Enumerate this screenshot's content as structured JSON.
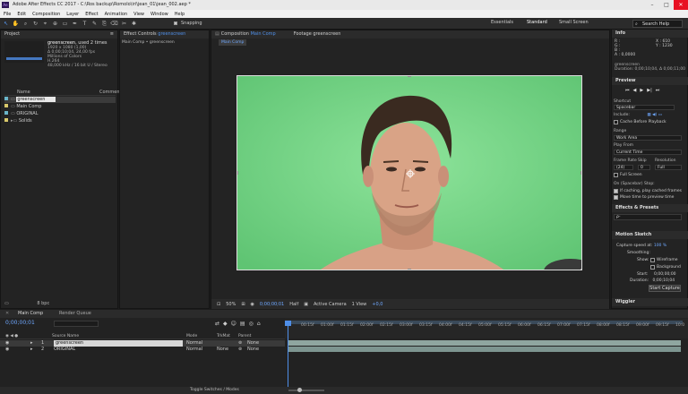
{
  "app": {
    "title": "Adobe After Effects CC 2017 - C:\\Ros backup\\Romolo\\iri\\jean_01\\jean_002.aep *",
    "menu": [
      "File",
      "Edit",
      "Composition",
      "Layer",
      "Effect",
      "Animation",
      "View",
      "Window",
      "Help"
    ],
    "snapping": "Snapping",
    "workspaces": [
      "Essentials",
      "Standard",
      "Small Screen"
    ],
    "search_help": "Search Help",
    "tools": [
      "selection",
      "hand",
      "zoom",
      "rotate",
      "camera",
      "pan-behind",
      "rectangle",
      "pen",
      "type",
      "brush",
      "clone",
      "eraser",
      "roto",
      "puppet"
    ]
  },
  "project": {
    "tab": "Project",
    "thumb_name": "greenscreen",
    "thumb_used": ", used 2 times",
    "info_lines": [
      "1920 x 1080 (1,00)",
      "Δ 0;00;10;04, 24,00 fps",
      "Millions of Colors",
      "H.264",
      "48,000 kHz / 16 bit U / Stereo"
    ],
    "col_name": "Name",
    "col_comment": "Comment",
    "items": [
      {
        "name": "greenscreen",
        "color": "#6ab5c9"
      },
      {
        "name": "Main Comp",
        "color": "#d8c86a"
      },
      {
        "name": "ORIGINAL",
        "color": "#6ab5c9"
      },
      {
        "name": "Solids",
        "color": "#d8c86a"
      }
    ],
    "bpc": "8 bpc"
  },
  "effect_controls": {
    "tab_prefix": "Effect Controls",
    "tab_target": "greenscreen",
    "breadcrumb": "Main Comp • greenscreen"
  },
  "composition": {
    "tab_prefix": "Composition",
    "tab_name": "Main Comp",
    "footage_tab": "Footage greenscreen",
    "sub_tab": "Main Comp",
    "zoom": "50%",
    "timecode": "0;00;00;01",
    "resolution": "Half",
    "camera": "Active Camera",
    "views": "1 View",
    "exposure": "+0,0"
  },
  "info": {
    "title": "Info",
    "rgb": [
      "R :",
      "G :",
      "B :",
      "A : 0,0000"
    ],
    "xy": [
      "X : 610",
      "Y : 1230"
    ],
    "footage": "greenscreen",
    "duration": "Duration: 0;00;10;04, Δ 0;00;11;00"
  },
  "preview": {
    "title": "Preview",
    "shortcut_label": "Shortcut",
    "shortcut": "Spacebar",
    "include_label": "Include:",
    "cache": "Cache Before Playback",
    "range_label": "Range",
    "range": "Work Area",
    "play_from_label": "Play From",
    "play_from": "Current Time",
    "frame_rate_label": "Frame Rate",
    "skip_label": "Skip",
    "resolution_label": "Resolution",
    "frame_rate": "(24)",
    "skip": "0",
    "resolution": "Full",
    "full_screen": "Full Screen",
    "stop_label": "On (Spacebar) Stop:",
    "if_caching": "If caching, play cached frames",
    "move_time": "Move time to preview time"
  },
  "effects_presets": {
    "title": "Effects & Presets",
    "search_placeholder": "ρ-"
  },
  "motion_sketch": {
    "title": "Motion Sketch",
    "capture_speed": "Capture speed at:",
    "capture_value": "100 %",
    "smoothing": "Smoothing:",
    "show": "Show:",
    "wireframe": "Wireframe",
    "background": "Background",
    "start_label": "Start:",
    "start": "0;00;00;00",
    "duration_label": "Duration:",
    "duration": "0;00;10;04",
    "start_capture": "Start Capture",
    "wiggler": "Wiggler"
  },
  "timeline": {
    "tab": "Main Comp",
    "render_queue": "Render Queue",
    "timecode": "0;00;00;01",
    "col_source": "Source Name",
    "col_mode": "Mode",
    "col_trkmat": "TrkMat",
    "col_parent": "Parent",
    "layers": [
      {
        "num": "1",
        "name": "greenscreen",
        "mode": "Normal",
        "trkmat": "",
        "parent": "None",
        "selected": true
      },
      {
        "num": "2",
        "name": "ORIGINAL",
        "mode": "Normal",
        "trkmat": "None",
        "parent": "None",
        "selected": false
      }
    ],
    "ticks": [
      "00:15f",
      "01:00f",
      "01:15f",
      "02:00f",
      "02:15f",
      "03:00f",
      "03:15f",
      "04:00f",
      "04:15f",
      "05:00f",
      "05:15f",
      "06:00f",
      "06:15f",
      "07:00f",
      "07:15f",
      "08:00f",
      "08:15f",
      "09:00f",
      "09:15f",
      "10:0"
    ],
    "toggle": "Toggle Switches / Modes"
  }
}
